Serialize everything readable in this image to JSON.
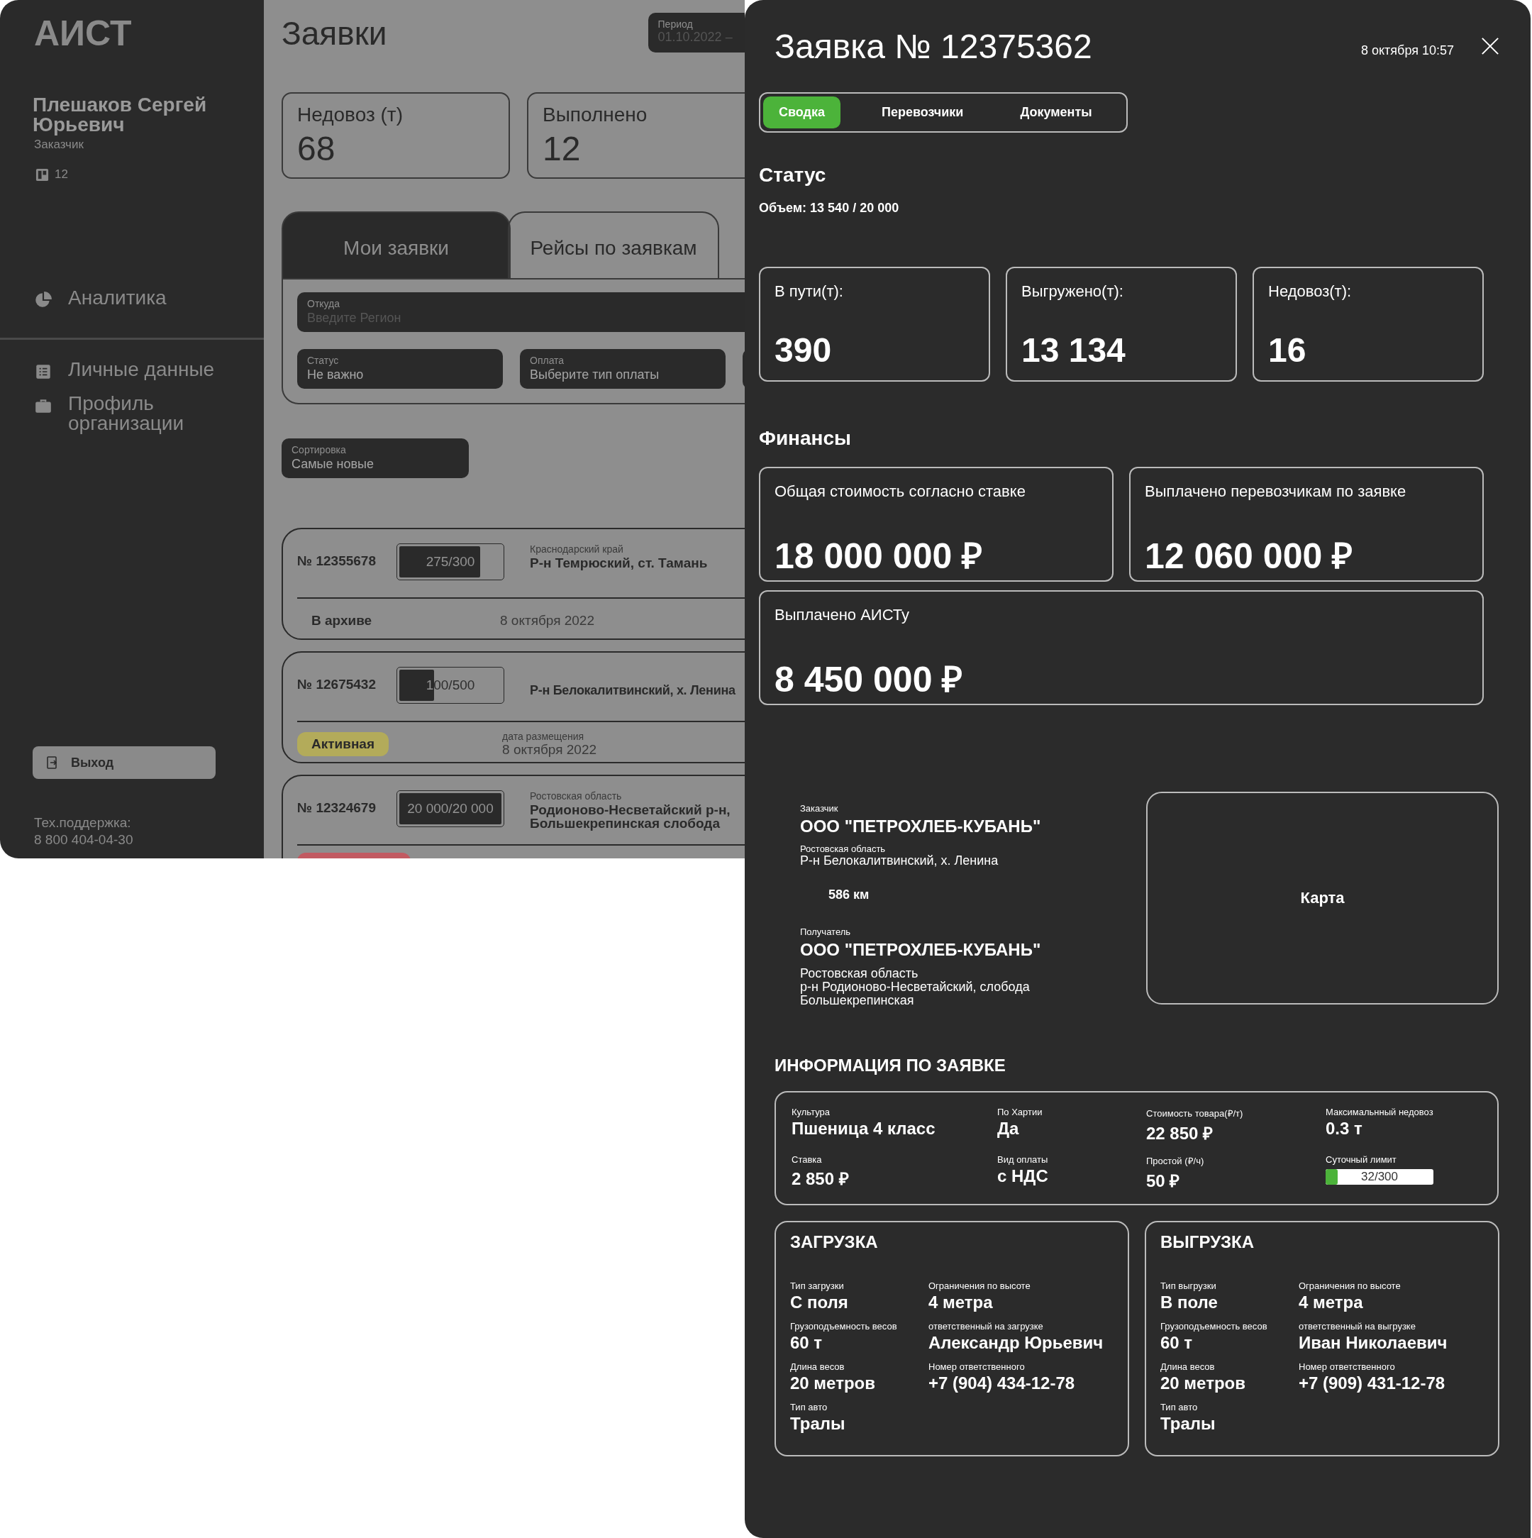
{
  "sidebar": {
    "logo": "АИСТ",
    "user": {
      "name": "Плешаков Сергей Юрьевич",
      "role": "Заказчик",
      "count": "12"
    },
    "nav_groups": [
      [
        {
          "label": "Аналитика"
        }
      ],
      [
        {
          "label": "Личные данные"
        },
        {
          "label": "Профиль организации"
        }
      ]
    ],
    "logout": "Выход",
    "support": {
      "label": "Тех.поддержка:",
      "phone": "8 800 404-04-30"
    }
  },
  "main": {
    "title": "Заявки",
    "period": {
      "label": "Период",
      "value": "01.10.2022 –"
    },
    "stats": [
      {
        "label": "Недовоз (т)",
        "value": "68"
      },
      {
        "label": "Выполнено",
        "value": "12"
      }
    ],
    "tabs": [
      {
        "label": "Мои заявки",
        "selected": true
      },
      {
        "label": "Рейсы по заявкам",
        "selected": false
      }
    ],
    "filters": {
      "from": {
        "label": "Откуда",
        "placeholder": "Введите Регион"
      },
      "fields": [
        {
          "label": "Статус",
          "value": "Не важно"
        },
        {
          "label": "Оплата",
          "value": "Выберите тип оплаты"
        }
      ]
    },
    "sort": {
      "label": "Сортировка",
      "value": "Самые новые"
    },
    "orders": [
      {
        "number": "№ 12355678",
        "volume": "275/300",
        "level": 0.79,
        "region": "Краснодарский край",
        "address": "Р-н Темрюский, ст. Тамань",
        "status": {
          "label": "В архиве"
        },
        "date": "8 октября 2022"
      },
      {
        "number": "№ 12675432",
        "volume": "100/500",
        "level": 0.34,
        "address": "Р-н Белокалитвинский, х. Ленина",
        "status": {
          "label": "Активная",
          "color": "#b3ab5a"
        },
        "date_label": "дата размещения",
        "date": "8 октября 2022"
      },
      {
        "number": "№ 12324679",
        "volume": "20 000/20 000",
        "level": 1,
        "region": "Ростовская область",
        "address": "Родионово-Несветайский р-н, Большекрепинская слобода",
        "status": {
          "color": "#c25a62"
        }
      }
    ]
  },
  "drawer": {
    "title": "Заявка № 12375362",
    "date": "8 октября 10:57",
    "tabs": [
      {
        "label": "Сводка",
        "selected": true
      },
      {
        "label": "Перевозчики",
        "selected": false
      },
      {
        "label": "Документы",
        "selected": false
      }
    ],
    "status": {
      "heading": "Статус",
      "volume": "Объем: 13 540 / 20 000",
      "stats": [
        {
          "label": "В пути(т):",
          "value": "390"
        },
        {
          "label": "Выгружено(т):",
          "value": "13 134"
        },
        {
          "label": "Недовоз(т):",
          "value": "16"
        }
      ]
    },
    "finance": {
      "heading": "Финансы",
      "cards": [
        {
          "label": "Общая стоимость согласно ставке",
          "value": "18 000 000 ₽",
          "wide": false
        },
        {
          "label": "Выплачено перевозчикам по заявке",
          "value": "12 060 000 ₽",
          "wide": false
        },
        {
          "label": "Выплачено АИСТу",
          "value": "8 450 000 ₽",
          "wide": true
        }
      ]
    },
    "route": {
      "customer": {
        "label": "Заказчик",
        "name": "ООО \"ПЕТРОХЛЕБ-КУБАНЬ\"",
        "region": "Ростовская область",
        "address": "Р-н Белокалитвинский, х. Ленина"
      },
      "distance": "586 км",
      "recipient": {
        "label": "Получатель",
        "name": "ООО \"ПЕТРОХЛЕБ-КУБАНЬ\"",
        "region": "Ростовская область",
        "address": "р-н Родионово-Несветайский, слобода Большекрепинская"
      },
      "map": "Карта"
    },
    "info": {
      "heading": "ИНФОРМАЦИЯ ПО ЗАЯВКЕ",
      "fields": [
        {
          "kind": "text",
          "label": "Культура",
          "value": "Пшеница 4 класс"
        },
        {
          "kind": "text",
          "label": "По Хартии",
          "value": "Да"
        },
        {
          "kind": "text",
          "label": "Стоимость товара(₽/т)",
          "value": "22 850 ₽"
        },
        {
          "kind": "text",
          "label": "Максимальнный недовоз",
          "value": "0.3 т"
        },
        {
          "kind": "text",
          "label": "Ставка",
          "value": "2 850 ₽"
        },
        {
          "kind": "text",
          "label": "Вид оплаты",
          "value": "с НДС"
        },
        {
          "kind": "text",
          "label": "Простой (₽/ч)",
          "value": "50 ₽"
        },
        {
          "kind": "meter",
          "label": "Суточный лимит",
          "value": "32/300",
          "level": 0.11
        }
      ]
    },
    "sections": [
      {
        "title": "ЗАГРУЗКА",
        "fields": [
          {
            "label": "Тип загрузки",
            "value": "С поля"
          },
          {
            "label": "Ограничения по высоте",
            "value": "4 метра"
          },
          {
            "label": "Грузоподъемность весов",
            "value": "60 т"
          },
          {
            "label": "ответственный на загрузке",
            "value": "Александр Юрьевич"
          },
          {
            "label": "Длина весов",
            "value": "20 метров"
          },
          {
            "label": "Номер ответственного",
            "value": "+7 (904) 434-12-78"
          },
          {
            "label": "Тип авто",
            "value": "Тралы"
          }
        ]
      },
      {
        "title": "ВЫГРУЗКА",
        "fields": [
          {
            "label": "Тип выгрузки",
            "value": "В поле"
          },
          {
            "label": "Ограничения по высоте",
            "value": "4 метра"
          },
          {
            "label": "Грузоподъемность весов",
            "value": "60 т"
          },
          {
            "label": "ответственный на выгрузке",
            "value": "Иван Николаевич"
          },
          {
            "label": "Длина весов",
            "value": "20 метров"
          },
          {
            "label": "Номер ответственного",
            "value": "+7 (909) 431-12-78"
          },
          {
            "label": "Тип авто",
            "value": "Тралы"
          }
        ]
      }
    ]
  }
}
